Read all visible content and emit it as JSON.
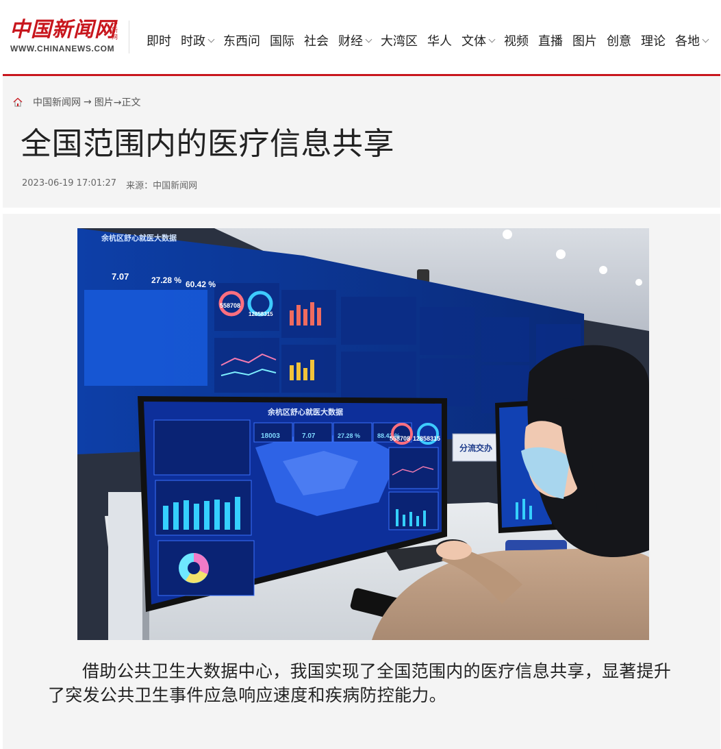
{
  "site": {
    "logo_cn": "中国新闻网",
    "logo_vertical": "中新网",
    "logo_url": "WWW.CHINANEWS.COM"
  },
  "nav": {
    "items": [
      {
        "label": "即时",
        "dropdown": false
      },
      {
        "label": "时政",
        "dropdown": true
      },
      {
        "label": "东西问",
        "dropdown": false
      },
      {
        "label": "国际",
        "dropdown": false
      },
      {
        "label": "社会",
        "dropdown": false
      },
      {
        "label": "财经",
        "dropdown": true
      },
      {
        "label": "大湾区",
        "dropdown": false
      },
      {
        "label": "华人",
        "dropdown": false
      },
      {
        "label": "文体",
        "dropdown": true
      },
      {
        "label": "视频",
        "dropdown": false
      },
      {
        "label": "直播",
        "dropdown": false
      },
      {
        "label": "图片",
        "dropdown": false
      },
      {
        "label": "创意",
        "dropdown": false
      },
      {
        "label": "理论",
        "dropdown": false
      },
      {
        "label": "各地",
        "dropdown": true
      }
    ]
  },
  "breadcrumb": {
    "home": "中国新闻网",
    "arrow1": "→",
    "section": "图片→正文"
  },
  "article": {
    "title": "全国范围内的医疗信息共享",
    "datetime": "2023-06-19 17:01:27",
    "source": "来源：中国新闻网",
    "caption": "借助公共卫生大数据中心，我国实现了全国范围内的医疗信息共享，显著提升了突发公共卫生事件应急响应速度和疾病防控能力。"
  },
  "photo": {
    "screen_title": "余杭区舒心就医大数据",
    "stat1": "18003",
    "stat2": "7.07",
    "stat3": "27.28 %",
    "stat4": "88.42 %",
    "gauge1": "558708",
    "gauge2": "12858315",
    "desk_sign": "分流交办",
    "wall_title": "余杭区舒心就医大数据",
    "wall_value1": "7.07",
    "wall_value2": "27.28 %",
    "wall_value3": "60.42 %",
    "wall_gauge1": "558708",
    "wall_gauge2": "12858315"
  },
  "colors": {
    "brand_red": "#c8161d",
    "panel_bg": "#f4f4f4",
    "screen_blue": "#1140c8"
  },
  "icons": {
    "home": "home-icon",
    "dropdown": "chevron-down-icon"
  }
}
